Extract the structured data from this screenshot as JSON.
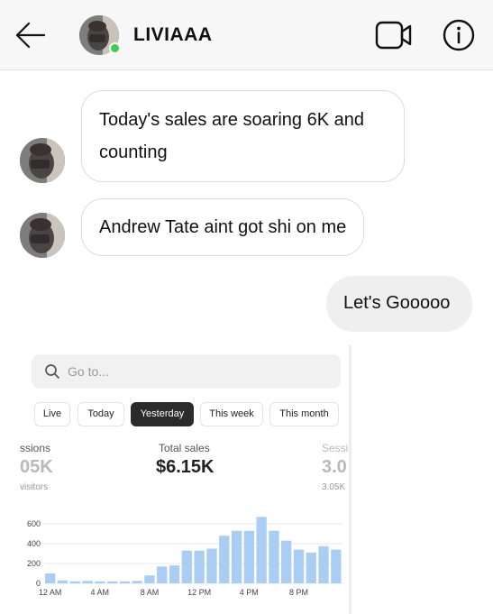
{
  "header": {
    "username": "LIVIAAA",
    "back_icon": "arrow-left-icon",
    "video_icon": "video-camera-icon",
    "info_icon": "info-icon",
    "online_color": "#3fcd4f"
  },
  "messages": [
    {
      "direction": "incoming",
      "text": "Today's sales are soaring 6K and counting"
    },
    {
      "direction": "incoming",
      "text": "Andrew Tate aint got shi on me"
    },
    {
      "direction": "outgoing",
      "text": "Let's Gooooo"
    }
  ],
  "shared_image": {
    "search_placeholder": "Go to...",
    "ranges": [
      "Live",
      "Today",
      "Yesterday",
      "This week",
      "This month"
    ],
    "selected_range": "Yesterday",
    "metrics": {
      "left_label": "ssions",
      "left_value": "05K",
      "left_sub": "visitors",
      "center_label": "Total sales",
      "center_value": "$6.15K",
      "right_label": "Sessio",
      "right_value": "3.0",
      "right_sub": "3.05K"
    },
    "chart_data": {
      "type": "bar",
      "title": "",
      "xlabel": "",
      "ylabel": "",
      "ylim": [
        0,
        700
      ],
      "yticks": [
        0,
        200,
        400,
        600
      ],
      "x_tick_labels": [
        "12 AM",
        "4 AM",
        "8 AM",
        "12 PM",
        "4 PM",
        "8 PM"
      ],
      "values": [
        100,
        30,
        20,
        25,
        20,
        20,
        20,
        25,
        80,
        170,
        180,
        330,
        330,
        350,
        480,
        530,
        530,
        670,
        530,
        430,
        340,
        310,
        375,
        340
      ],
      "color": "#aacdf3",
      "grid": true
    }
  }
}
